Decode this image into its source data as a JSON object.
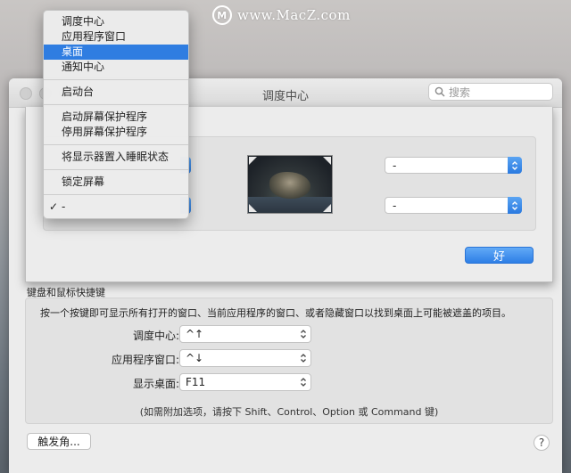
{
  "watermark": {
    "logo_letter": "M",
    "text": "www.MacZ.com"
  },
  "window": {
    "title": "调度中心",
    "search_placeholder": "搜索"
  },
  "hot_corners_sheet": {
    "top_right_value": "-",
    "bottom_right_value": "-",
    "ok_label": "好"
  },
  "keyboard": {
    "section_title": "键盘和鼠标快捷键",
    "description": "按一个按键即可显示所有打开的窗口、当前应用程序的窗口、或者隐藏窗口以找到桌面上可能被遮盖的项目。",
    "rows": [
      {
        "label": "调度中心:",
        "value": "^↑"
      },
      {
        "label": "应用程序窗口:",
        "value": "^↓"
      },
      {
        "label": "显示桌面:",
        "value": "F11"
      }
    ],
    "note": "(如需附加选项，请按下 Shift、Control、Option 或 Command 键)"
  },
  "hot_corners_button": "触发角...",
  "help_button": "?",
  "menu": {
    "group1": [
      "调度中心",
      "应用程序窗口",
      "桌面",
      "通知中心"
    ],
    "group2": [
      "启动台"
    ],
    "group3": [
      "启动屏幕保护程序",
      "停用屏幕保护程序"
    ],
    "group4": [
      "将显示器置入睡眠状态"
    ],
    "group5": [
      "锁定屏幕"
    ],
    "group6": [
      "-"
    ],
    "selected_item": "桌面",
    "checked_item": "-",
    "check_mark": "✓"
  },
  "colors": {
    "accent": "#2f7de1",
    "window_bg": "#ececec",
    "panel_bg": "#e2e2e2"
  }
}
